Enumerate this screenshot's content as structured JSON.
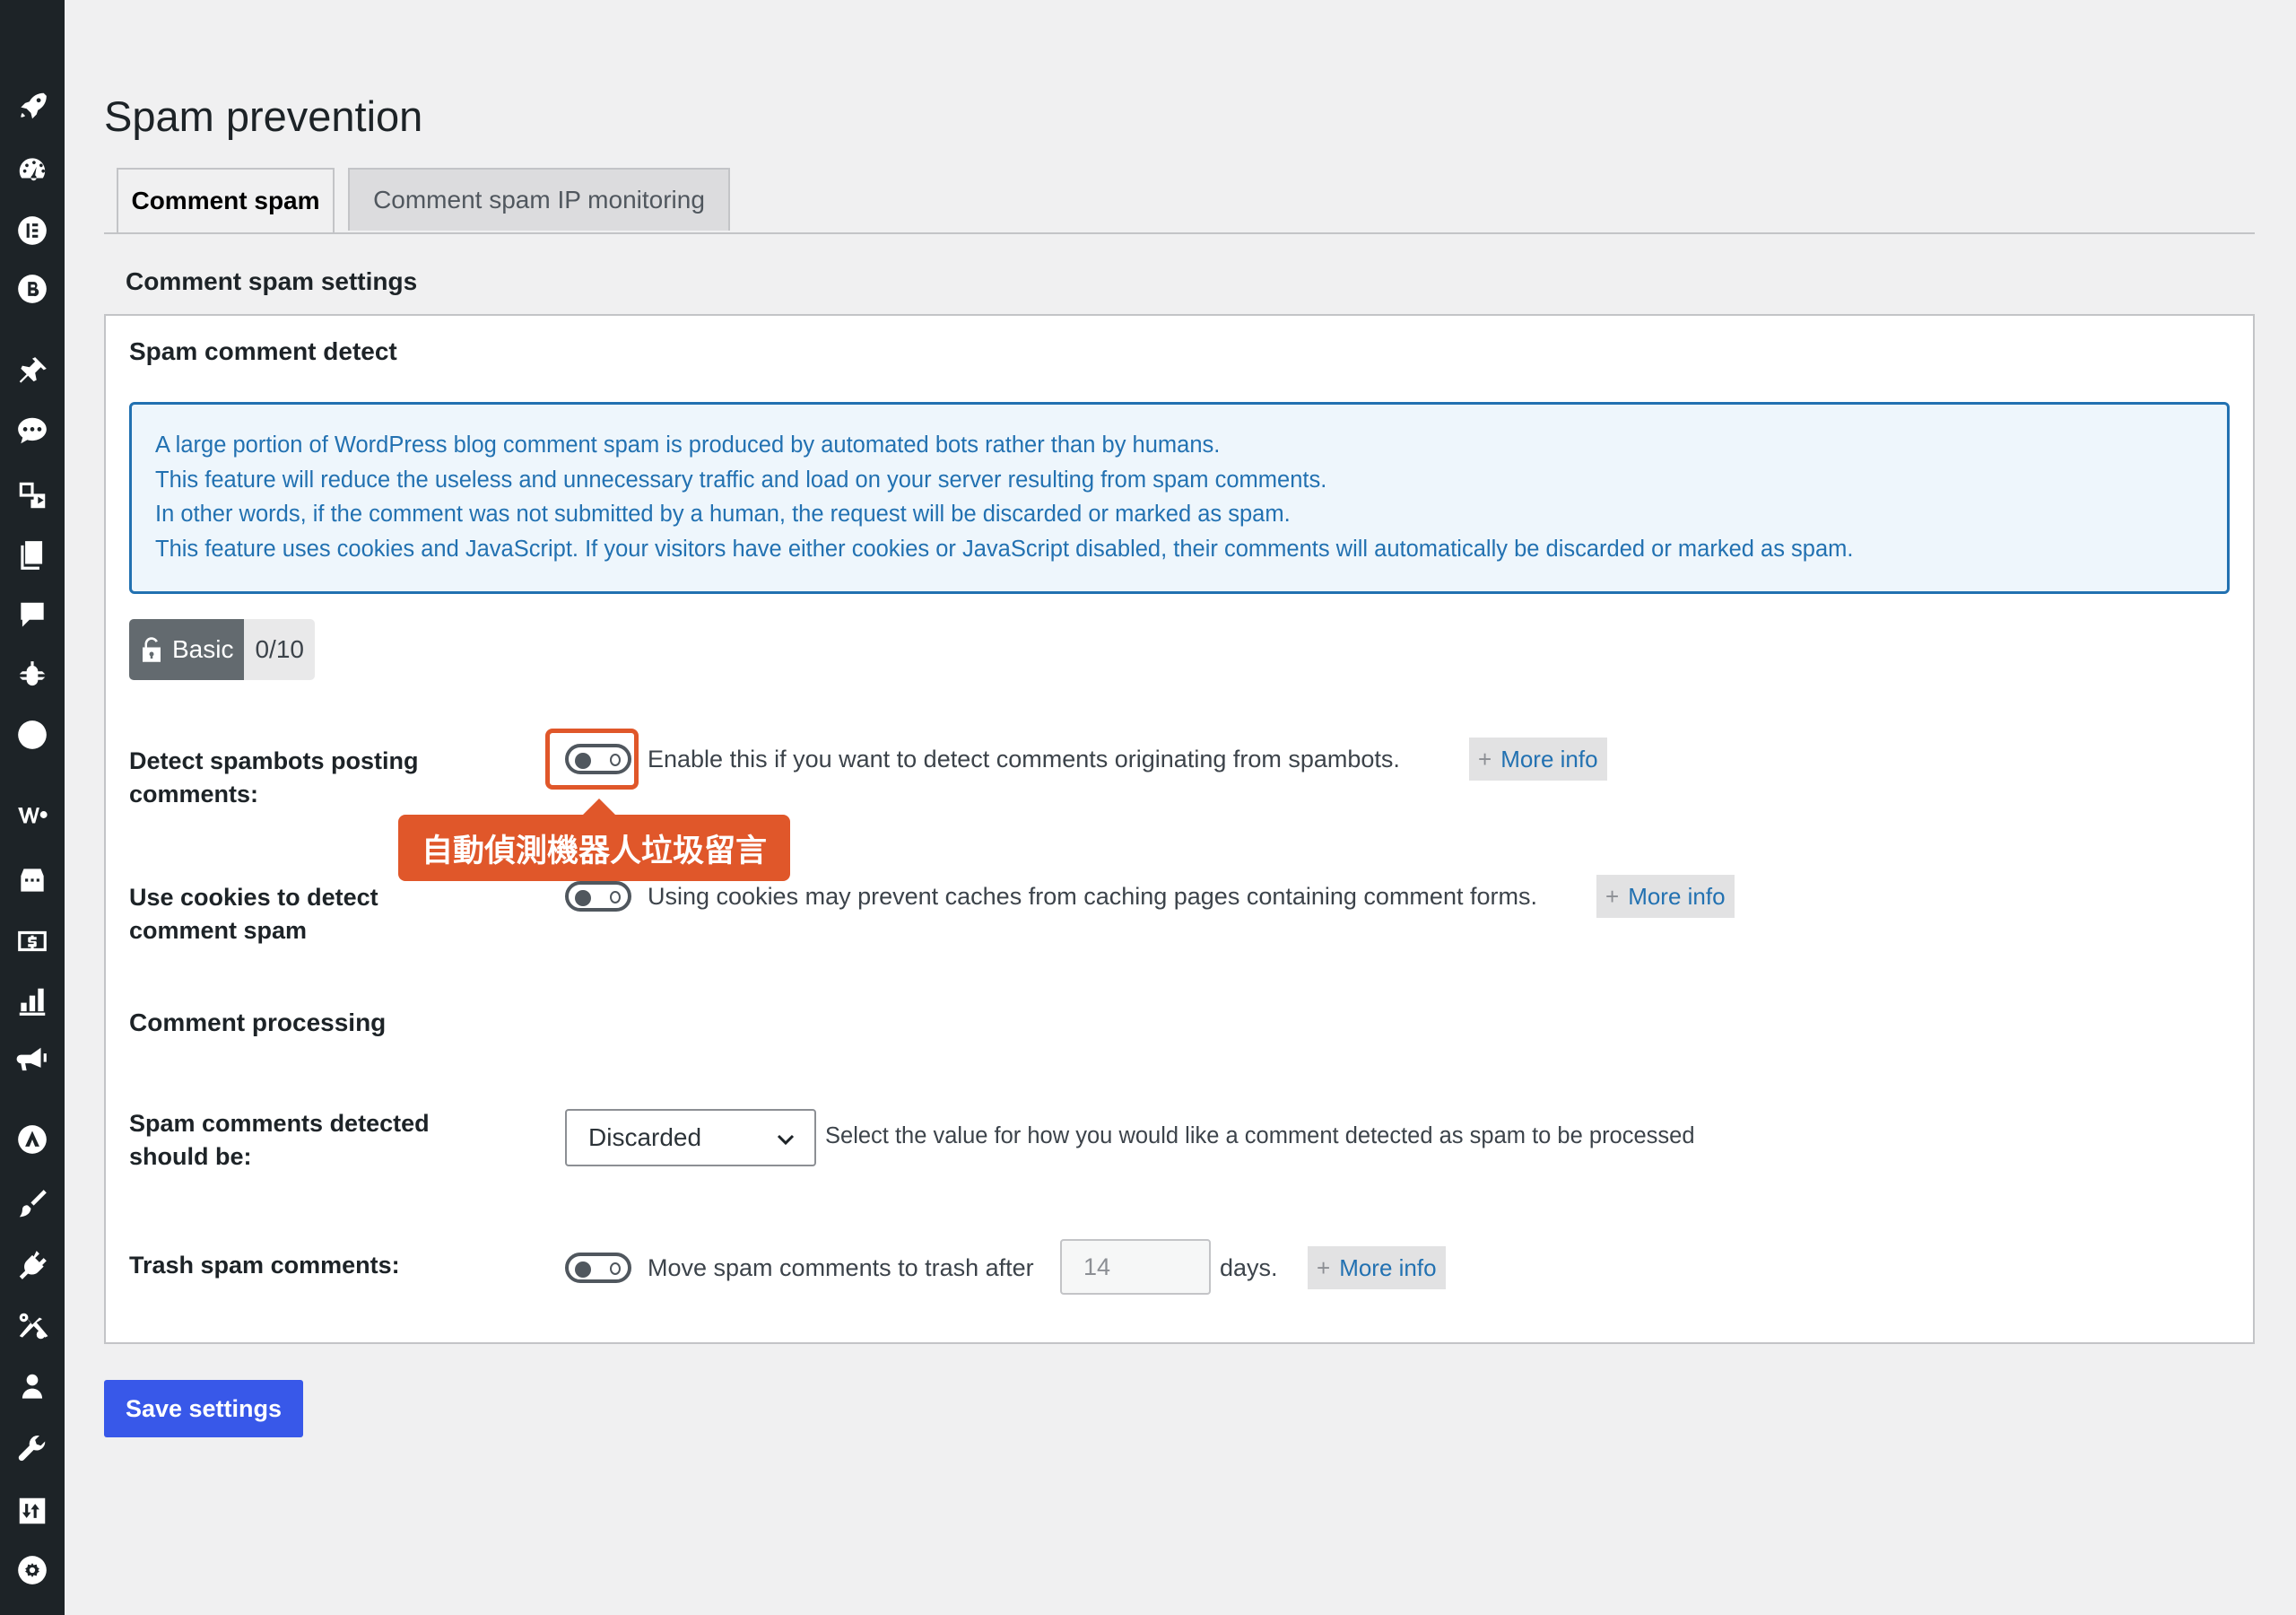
{
  "sidebar": {
    "icons": [
      "rocket-icon",
      "dashboard-icon",
      "elementor-icon",
      "b-logo-icon",
      "pin-icon",
      "comments-bubbles-icon",
      "media-icon",
      "pages-icon",
      "comment-icon",
      "bug-icon",
      "bolt-circle-icon",
      "woo-icon",
      "store-icon",
      "money-icon",
      "stats-icon",
      "megaphone-icon",
      "astra-icon",
      "brush-icon",
      "plugin-icon",
      "tools-scissors-icon",
      "user-icon",
      "wrench-icon",
      "import-export-icon",
      "gear-circle-icon"
    ]
  },
  "page": {
    "title": "Spam prevention"
  },
  "tabs": [
    {
      "label": "Comment spam",
      "active": true
    },
    {
      "label": "Comment spam IP monitoring",
      "active": false
    }
  ],
  "section": {
    "heading": "Comment spam settings"
  },
  "panel": {
    "title": "Spam comment detect",
    "notice_lines": [
      "A large portion of WordPress blog comment spam is produced by automated bots rather than by humans.",
      "This feature will reduce the useless and unnecessary traffic and load on your server resulting from spam comments.",
      "In other words, if the comment was not submitted by a human, the request will be discarded or marked as spam.",
      "This feature uses cookies and JavaScript. If your visitors have either cookies or JavaScript disabled, their comments will automatically be discarded or marked as spam."
    ],
    "badge": {
      "label": "Basic",
      "score": "0/10"
    },
    "rows": {
      "detect": {
        "label": "Detect spambots posting comments:",
        "enabled": false,
        "description": "Enable this if you want to detect comments originating from spambots.",
        "more_info": "More info"
      },
      "cookies": {
        "label": "Use cookies to detect comment spam",
        "enabled": false,
        "description": "Using cookies may prevent caches from caching pages containing comment forms.",
        "more_info": "More info"
      },
      "processing_heading": "Comment processing",
      "spam_processing": {
        "label": "Spam comments detected should be:",
        "selected": "Discarded",
        "description": "Select the value for how you would like a comment detected as spam to be processed"
      },
      "trash": {
        "label": "Trash spam comments:",
        "enabled": false,
        "description_before": "Move spam comments to trash after",
        "days_value": "14",
        "description_after": "days.",
        "more_info": "More info"
      }
    }
  },
  "annotation": {
    "callout_text": "自動偵測機器人垃圾留言",
    "color": "#e0572a"
  },
  "buttons": {
    "save_label": "Save settings"
  },
  "colors": {
    "accent": "#3858e9",
    "notice_blue": "#2271b1",
    "sidebar_bg": "#1d2327"
  }
}
